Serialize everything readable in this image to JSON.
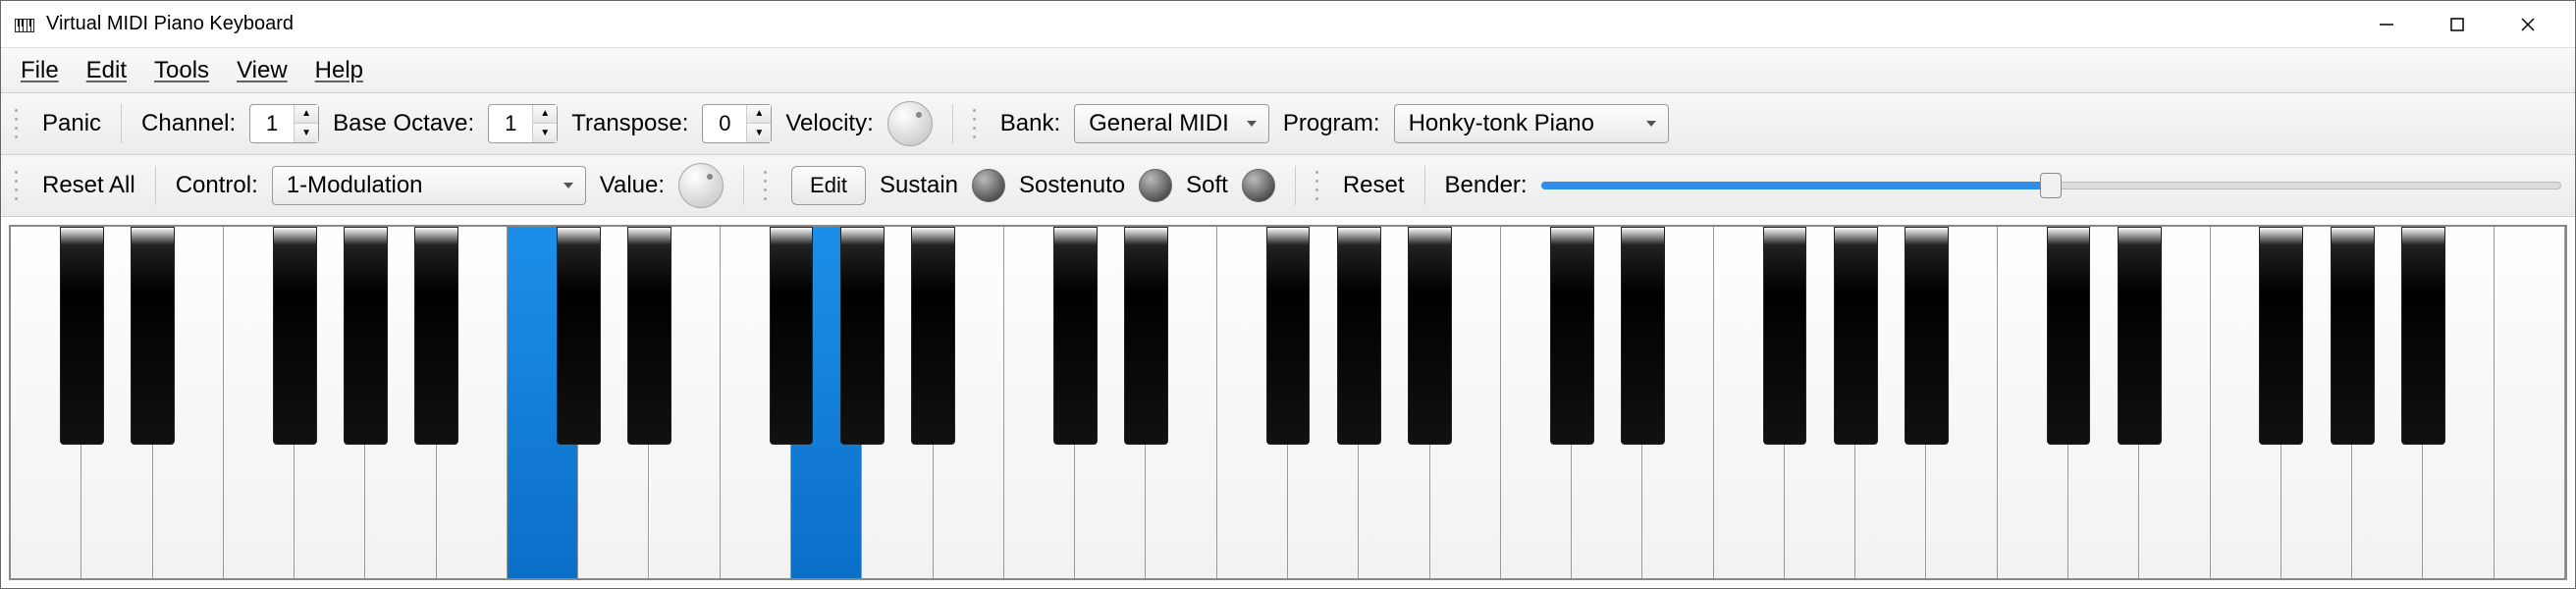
{
  "window": {
    "title": "Virtual MIDI Piano Keyboard"
  },
  "menu": {
    "file": "File",
    "edit": "Edit",
    "tools": "Tools",
    "view": "View",
    "help": "Help"
  },
  "toolbar1": {
    "panic": "Panic",
    "channel_label": "Channel:",
    "channel_value": "1",
    "base_octave_label": "Base Octave:",
    "base_octave_value": "1",
    "transpose_label": "Transpose:",
    "transpose_value": "0",
    "velocity_label": "Velocity:",
    "bank_label": "Bank:",
    "bank_value": "General MIDI",
    "program_label": "Program:",
    "program_value": "Honky-tonk Piano"
  },
  "toolbar2": {
    "reset_all": "Reset All",
    "control_label": "Control:",
    "control_value": "1-Modulation",
    "value_label": "Value:",
    "edit_btn": "Edit",
    "sustain": "Sustain",
    "sostenuto": "Sostenuto",
    "soft": "Soft",
    "reset": "Reset",
    "bender_label": "Bender:",
    "bender_percent": 50
  },
  "piano": {
    "white_count": 36,
    "start_note": "C",
    "pressed_white_indices": [
      7,
      11
    ],
    "pressed_black_positions": [
      9
    ]
  }
}
